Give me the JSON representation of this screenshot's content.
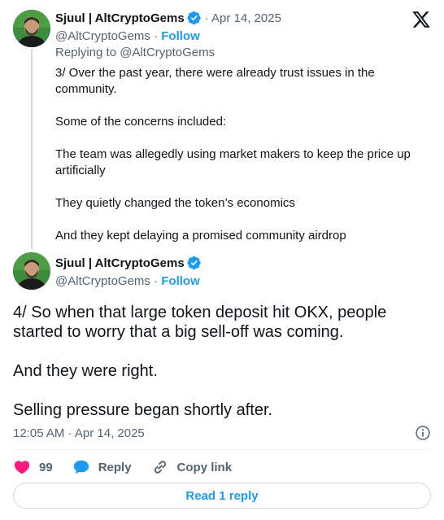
{
  "tweet1": {
    "display_name": "Sjuul | AltCryptoGems",
    "date": "· Apr 14, 2025",
    "handle": "@AltCryptoGems",
    "sep": " · ",
    "follow": "Follow",
    "replying_to": "Replying to @AltCryptoGems",
    "paragraphs": [
      "3/ Over the past year, there were already trust issues in the community.",
      "Some of the concerns included:",
      "The team was allegedly using market makers to keep the price up artificially",
      "They quietly changed the token’s economics",
      "And they kept delaying a promised community airdrop"
    ]
  },
  "tweet2": {
    "display_name": "Sjuul | AltCryptoGems",
    "handle": "@AltCryptoGems",
    "sep": " · ",
    "follow": "Follow",
    "paragraphs": [
      "4/ So when that large token deposit hit OKX, people started to worry that a big sell-off was coming.",
      "And they were right.",
      "Selling pressure began shortly after."
    ],
    "timestamp": "12:05 AM · Apr 14, 2025"
  },
  "actions": {
    "likes": "99",
    "reply": "Reply",
    "copy_link": "Copy link"
  },
  "read_replies": "Read 1 reply",
  "icons": {
    "x_logo": "x-logo-icon",
    "verified": "verified-badge-icon",
    "info": "info-icon",
    "heart": "heart-icon",
    "reply": "reply-bubble-icon",
    "link": "link-icon"
  },
  "colors": {
    "accent": "#1d9bf0",
    "like": "#f91880",
    "muted": "#536471",
    "text": "#0f1419"
  }
}
